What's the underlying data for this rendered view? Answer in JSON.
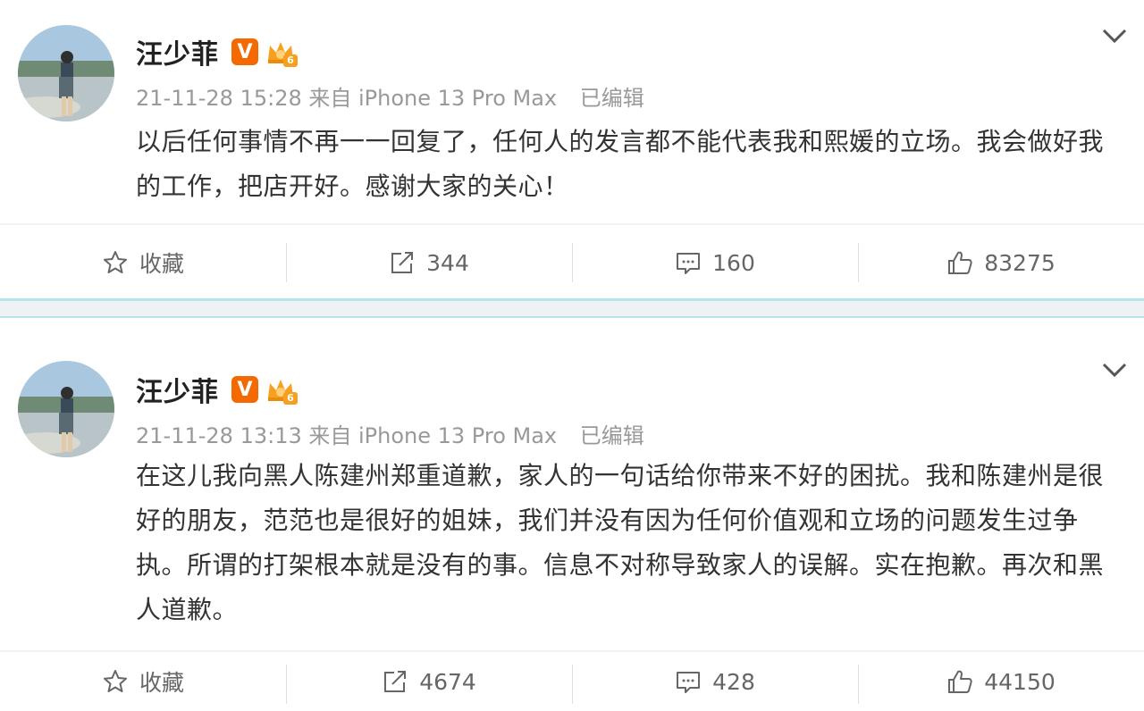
{
  "posts": [
    {
      "username": "汪少菲",
      "badge_v": "V",
      "crown_level": "6",
      "timestamp": "21-11-28 15:28",
      "source": "来自 iPhone 13 Pro Max",
      "edited": "已编辑",
      "content": "以后任何事情不再一一回复了，任何人的发言都不能代表我和熙媛的立场。我会做好我的工作，把店开好。感谢大家的关心！",
      "actions": {
        "favorite": "收藏",
        "repost": "344",
        "comment": "160",
        "like": "83275"
      }
    },
    {
      "username": "汪少菲",
      "badge_v": "V",
      "crown_level": "6",
      "timestamp": "21-11-28 13:13",
      "source": "来自 iPhone 13 Pro Max",
      "edited": "已编辑",
      "content": "在这儿我向黑人陈建州郑重道歉，家人的一句话给你带来不好的困扰。我和陈建州是很好的朋友，范范也是很好的姐妹，我们并没有因为任何价值观和立场的问题发生过争执。所谓的打架根本就是没有的事。信息不对称导致家人的误解。实在抱歉。再次和黑人道歉。",
      "actions": {
        "favorite": "收藏",
        "repost": "4674",
        "comment": "428",
        "like": "44150"
      }
    }
  ],
  "colors": {
    "verified_badge": "#f56a00",
    "separator": "#b7e4ea",
    "meta_text": "#999999"
  },
  "icons": [
    "avatar-photo",
    "verified-v-icon",
    "crown-vip-icon",
    "chevron-down-icon",
    "star-icon",
    "repost-icon",
    "comment-icon",
    "thumbs-up-icon"
  ]
}
